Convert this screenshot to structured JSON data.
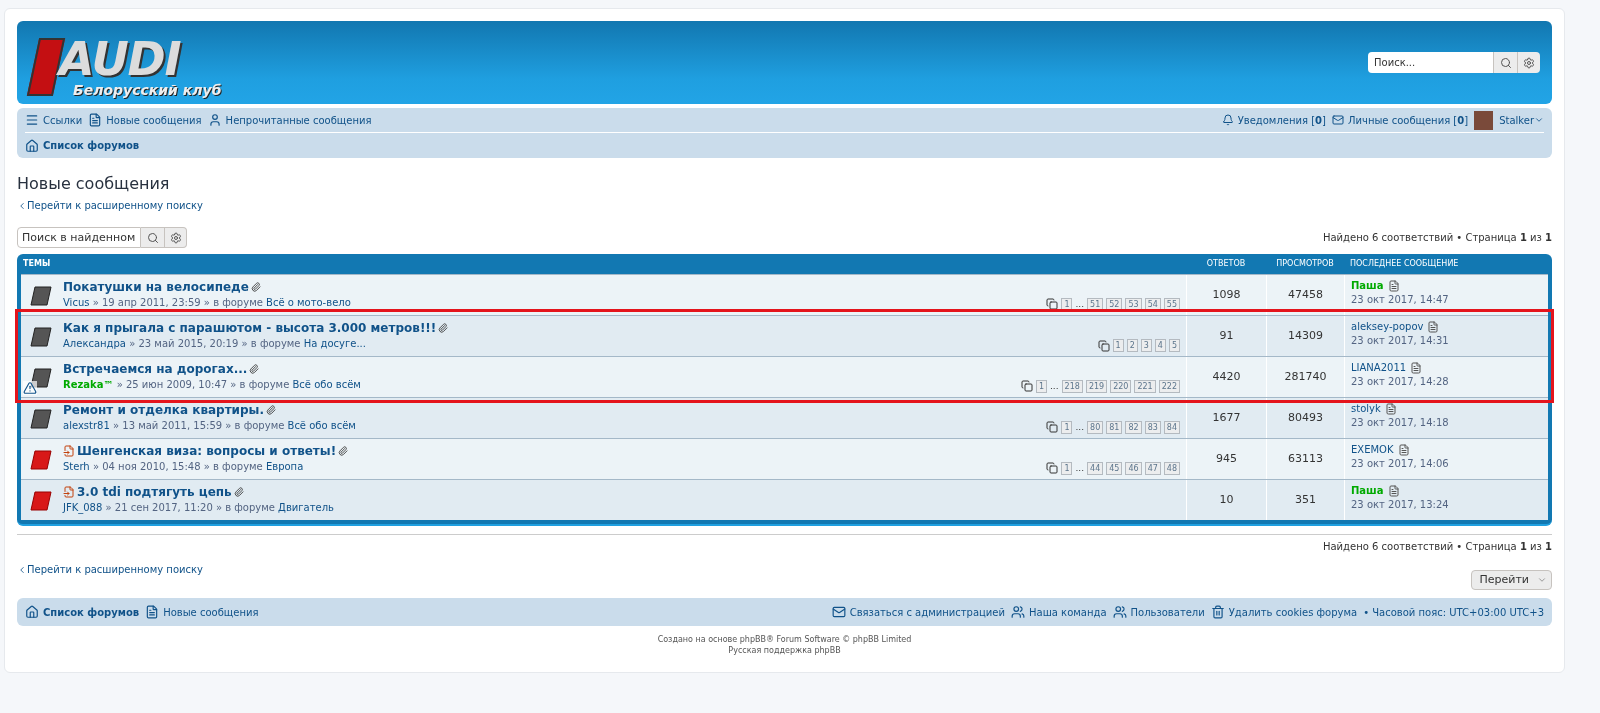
{
  "logo": {
    "title": "AUDI",
    "subtitle": "Белорусский клуб"
  },
  "header_search": {
    "placeholder": "Поиск..."
  },
  "navbar": {
    "left": [
      {
        "kind": "menu",
        "label": "Ссылки"
      },
      {
        "kind": "new",
        "label": "Новые сообщения"
      },
      {
        "kind": "unread",
        "label": "Непрочитанные сообщения"
      }
    ],
    "notifications": {
      "label": "Уведомления",
      "count": "[**0**]"
    },
    "messages": {
      "label": "Личные сообщения",
      "count": "[**0**]"
    },
    "user": "Stalker",
    "breadcrumb": "Список форумов"
  },
  "page_title": "Новые сообщения",
  "advanced_link_top": "Перейти к расширенному поиску",
  "result_search": {
    "placeholder": "Поиск в найденном"
  },
  "pagination_info_top": "Найдено 6 соответствий • Страница **1** из **1**",
  "table": {
    "columns": [
      "ТЕМЫ",
      "ОТВЕТОВ",
      "ПРОСМОТРОВ",
      "ПОСЛЕДНЕЕ СООБЩЕНИЕ"
    ],
    "rows": [
      {
        "title": "Покатушки на велосипеде",
        "author": "Vicus",
        "author_colored": false,
        "date": "» 19 апр 2011, 23:59 » в форуме",
        "forum": "Всё о мото-вело",
        "unread": false,
        "reported": false,
        "highlighted": false,
        "pages": [
          {
            "kind": "page",
            "label": "1"
          },
          {
            "kind": "gap",
            "label": "..."
          },
          {
            "kind": "page",
            "label": "51"
          },
          {
            "kind": "page",
            "label": "52"
          },
          {
            "kind": "page",
            "label": "53"
          },
          {
            "kind": "page",
            "label": "54"
          },
          {
            "kind": "page",
            "label": "55"
          }
        ],
        "replies": "1098",
        "views": "47458",
        "last_author": "Паша",
        "last_colored": true,
        "last_date": "23 окт 2017, 14:47"
      },
      {
        "title": "Как я прыгала с парашютом - высота 3.000 метров!!!",
        "author": "Александра",
        "author_colored": false,
        "date": "» 23 май 2015, 20:19 » в форуме",
        "forum": "На досуге...",
        "unread": false,
        "reported": false,
        "highlighted": true,
        "pages": [
          {
            "kind": "page",
            "label": "1"
          },
          {
            "kind": "page",
            "label": "2"
          },
          {
            "kind": "page",
            "label": "3"
          },
          {
            "kind": "page",
            "label": "4"
          },
          {
            "kind": "page",
            "label": "5"
          }
        ],
        "replies": "91",
        "views": "14309",
        "last_author": "aleksey-popov",
        "last_colored": false,
        "last_date": "23 окт 2017, 14:31"
      },
      {
        "title": "Встречаемся на дорогах...",
        "author": "Rezaka™",
        "author_colored": true,
        "date": "» 25 июн 2009, 10:47 » в форуме",
        "forum": "Всё обо всём",
        "unread": false,
        "reported": true,
        "highlighted": true,
        "pages": [
          {
            "kind": "page",
            "label": "1"
          },
          {
            "kind": "gap",
            "label": "..."
          },
          {
            "kind": "page",
            "label": "218"
          },
          {
            "kind": "page",
            "label": "219"
          },
          {
            "kind": "page",
            "label": "220"
          },
          {
            "kind": "page",
            "label": "221"
          },
          {
            "kind": "page",
            "label": "222"
          }
        ],
        "replies": "4420",
        "views": "281740",
        "last_author": "LIANA2011",
        "last_colored": false,
        "last_date": "23 окт 2017, 14:28"
      },
      {
        "title": "Ремонт и отделка квартиры.",
        "author": "alexstr81",
        "author_colored": false,
        "date": "» 13 май 2011, 15:59 » в форуме",
        "forum": "Всё обо всём",
        "unread": false,
        "reported": false,
        "highlighted": false,
        "pages": [
          {
            "kind": "page",
            "label": "1"
          },
          {
            "kind": "gap",
            "label": "..."
          },
          {
            "kind": "page",
            "label": "80"
          },
          {
            "kind": "page",
            "label": "81"
          },
          {
            "kind": "page",
            "label": "82"
          },
          {
            "kind": "page",
            "label": "83"
          },
          {
            "kind": "page",
            "label": "84"
          }
        ],
        "replies": "1677",
        "views": "80493",
        "last_author": "stolyk",
        "last_colored": false,
        "last_date": "23 окт 2017, 14:18"
      },
      {
        "title": "Шенгенская виза: вопросы и ответы!",
        "author": "Sterh",
        "author_colored": false,
        "date": "» 04 ноя 2010, 15:48 » в форуме",
        "forum": "Европа",
        "unread": true,
        "reported": false,
        "highlighted": false,
        "pages": [
          {
            "kind": "page",
            "label": "1"
          },
          {
            "kind": "gap",
            "label": "..."
          },
          {
            "kind": "page",
            "label": "44"
          },
          {
            "kind": "page",
            "label": "45"
          },
          {
            "kind": "page",
            "label": "46"
          },
          {
            "kind": "page",
            "label": "47"
          },
          {
            "kind": "page",
            "label": "48"
          }
        ],
        "replies": "945",
        "views": "63113",
        "last_author": "EXEMOK",
        "last_colored": false,
        "last_date": "23 окт 2017, 14:06"
      },
      {
        "title": "3.0 tdi подтягуть цепь",
        "author": "JFK_088",
        "author_colored": false,
        "date": "» 21 сен 2017, 11:20 » в форуме",
        "forum": "Двигатель",
        "unread": true,
        "reported": false,
        "highlighted": false,
        "pages": [],
        "replies": "10",
        "views": "351",
        "last_author": "Паша",
        "last_colored": true,
        "last_date": "23 окт 2017, 13:24"
      }
    ]
  },
  "pagination_info_bottom": "Найдено 6 соответствий • Страница **1** из **1**",
  "advanced_link_bottom": "Перейти к расширенному поиску",
  "jump_button": "Перейти",
  "footer_nav": {
    "left": [
      {
        "kind": "home",
        "label": "Список форумов"
      },
      {
        "kind": "new",
        "label": "Новые сообщения"
      }
    ],
    "right": [
      {
        "kind": "mail",
        "label": "Связаться с администрацией"
      },
      {
        "kind": "team",
        "label": "Наша команда"
      },
      {
        "kind": "users",
        "label": "Пользователи"
      },
      {
        "kind": "trash",
        "label": "Удалить cookies форума"
      }
    ],
    "timezone": "• Часовой пояс: UTC+03:00 UTC+3"
  },
  "copyright": [
    "Создано на основе phpBB® Forum Software © phpBB Limited",
    "Русская поддержка phpBB"
  ]
}
